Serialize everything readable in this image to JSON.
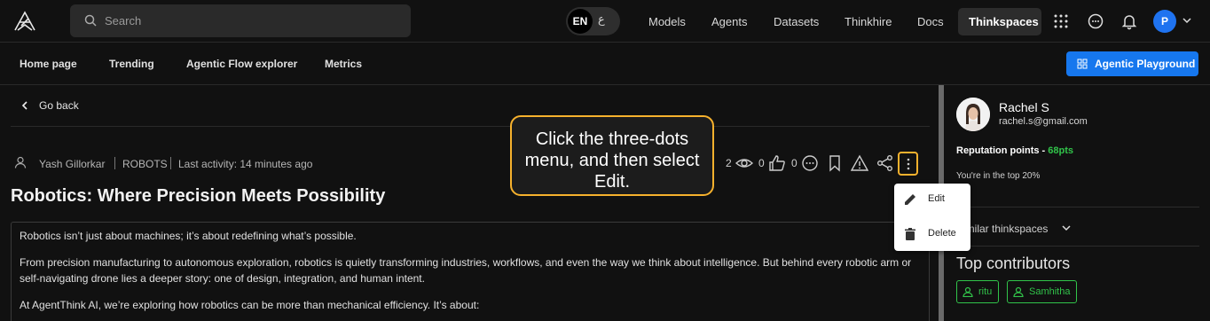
{
  "header": {
    "search_placeholder": "Search",
    "lang": {
      "en": "EN",
      "ar": "ع"
    },
    "nav": [
      "Models",
      "Agents",
      "Datasets",
      "Thinkhire",
      "Docs",
      "Thinkspaces"
    ],
    "active_nav": "Thinkspaces",
    "profile_initial": "P"
  },
  "subnav": {
    "links": [
      "Home page",
      "Trending",
      "Agentic Flow explorer",
      "Metrics"
    ],
    "playground_label": "Agentic Playground"
  },
  "post": {
    "go_back": "Go back",
    "author": "Yash Gillorkar",
    "category": "ROBOTS",
    "last_activity": "Last activity: 14 minutes ago",
    "title": "Robotics: Where Precision Meets Possibility",
    "views": "2",
    "likes": "0",
    "comments": "0",
    "paragraphs": [
      "Robotics isn’t just about machines; it’s about redefining what’s possible.",
      "From precision manufacturing to autonomous exploration, robotics is quietly transforming industries, workflows, and even the way we think about intelligence. But behind every robotic arm or self-navigating drone lies a deeper story: one of design, integration, and human intent.",
      "At AgentThink AI, we’re exploring how robotics can be more than mechanical efficiency. It’s about:"
    ]
  },
  "tooltip": "Click the three-dots menu, and then select Edit.",
  "menu": {
    "edit": "Edit",
    "delete": "Delete"
  },
  "profile": {
    "name": "Rachel S",
    "email": "rachel.s@gmail.com",
    "reputation_label": "Reputation points - ",
    "reputation_value": "68pts",
    "top_text": "You're in the top 20%",
    "similar_label": "Similar thinkspaces",
    "top_contributors": "Top contributors",
    "contributors": [
      "ritu",
      "Samhitha"
    ]
  },
  "colors": {
    "accent": "#1677ee",
    "highlight": "#f6b12d",
    "green": "#31c44a"
  }
}
